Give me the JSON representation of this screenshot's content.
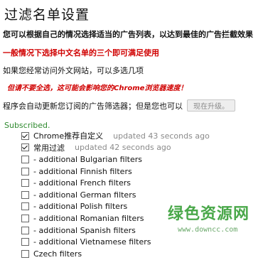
{
  "page": {
    "title": "过滤名单设置",
    "description": "您可以根据自己的情况选择适当的广告列表，以达到最佳的广告拦截效果",
    "recommend_red": "一般情况下选择中文名单的三个即可满足使用",
    "foreign_hint": "如果您经常访问外文网站，可以多选几项",
    "warning": "但请不要全选，这可能会影响您的Chrome浏览器速度！",
    "auto_update_text": "程序会自动更新您订阅的广告筛选器；但是您也可以",
    "update_button": "现在升级。"
  },
  "subscribed_label": "Subscribed.",
  "filters": [
    {
      "label": "Chrome推荐自定义",
      "checked": true,
      "updated": "updated 43 seconds ago"
    },
    {
      "label": "常用过滤",
      "checked": true,
      "updated": "updated 42 seconds ago"
    },
    {
      "label": "- additional Bulgarian filters",
      "checked": false,
      "updated": ""
    },
    {
      "label": "- additional Finnish filters",
      "checked": false,
      "updated": ""
    },
    {
      "label": "- additional French filters",
      "checked": false,
      "updated": ""
    },
    {
      "label": "- additional German filters",
      "checked": false,
      "updated": ""
    },
    {
      "label": "- additional Polish filters",
      "checked": false,
      "updated": ""
    },
    {
      "label": "- additional Romanian filters",
      "checked": false,
      "updated": ""
    },
    {
      "label": "- additional Spanish filters",
      "checked": false,
      "updated": ""
    },
    {
      "label": "- additional Vietnamese filters",
      "checked": false,
      "updated": ""
    },
    {
      "label": "Czech filters",
      "checked": false,
      "updated": ""
    }
  ],
  "watermark": {
    "logo": "绿色资源网",
    "url": "www.downcc.com"
  }
}
